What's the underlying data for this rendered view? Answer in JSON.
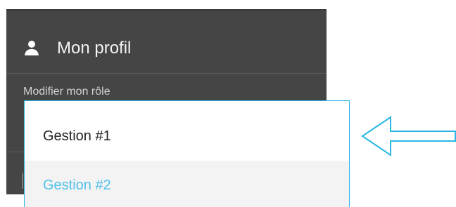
{
  "profile": {
    "title": "Mon profil",
    "icon": "user-icon",
    "role_label": "Modifier mon rôle"
  },
  "dropdown": {
    "options": [
      {
        "label": "Gestion #1",
        "state": "current"
      },
      {
        "label": "Gestion #2",
        "state": "highlighted"
      }
    ]
  },
  "colors": {
    "panel_background": "#454545",
    "dropdown_border": "#29b6e5",
    "highlight_text": "#4fc1ea",
    "highlight_background": "#f3f3f3",
    "arrow_stroke": "#29b6e5"
  },
  "annotation": {
    "icon": "left-arrow-icon"
  }
}
